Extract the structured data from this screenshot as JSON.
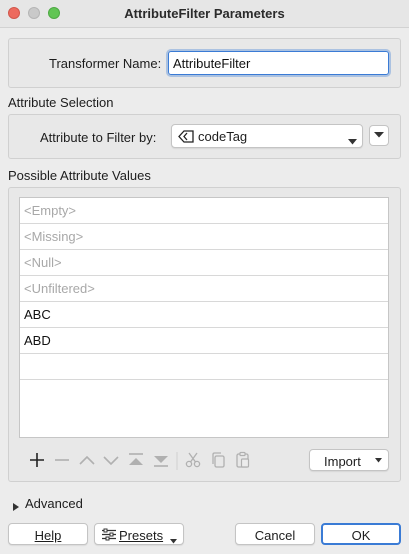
{
  "window": {
    "title": "AttributeFilter Parameters"
  },
  "transformer": {
    "label": "Transformer Name:",
    "value": "AttributeFilter"
  },
  "attribute_selection": {
    "section_label": "Attribute Selection",
    "label": "Attribute to Filter by:",
    "selected": "codeTag"
  },
  "possible_values": {
    "section_label": "Possible Attribute Values",
    "rows": [
      "<Empty>",
      "<Missing>",
      "<Null>",
      "<Unfiltered>",
      "ABC",
      "ABD",
      ""
    ]
  },
  "toolbar": {
    "import_label": "Import"
  },
  "advanced": {
    "label": "Advanced"
  },
  "footer": {
    "help_label": "Help",
    "presets_label": "Presets",
    "cancel_label": "Cancel",
    "ok_label": "OK"
  }
}
